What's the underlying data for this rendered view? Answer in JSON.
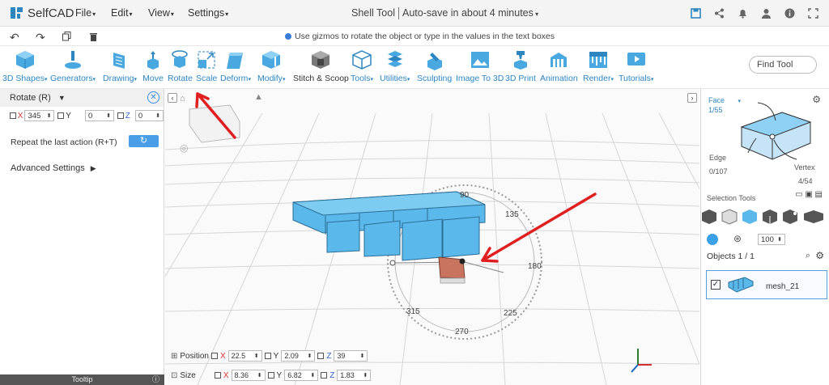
{
  "app": {
    "name": "SelfCAD"
  },
  "menu": {
    "file": "File",
    "edit": "Edit",
    "view": "View",
    "settings": "Settings"
  },
  "title": {
    "tool": "Shell Tool",
    "autosave": "Auto-save in about 4 minutes"
  },
  "hint": "Use gizmos to rotate the object or type in the values in the text boxes",
  "toolbar": {
    "items": [
      "3D Shapes",
      "Generators",
      "Drawing",
      "Move",
      "Rotate",
      "Scale",
      "Deform",
      "Modify",
      "Stitch & Scoop",
      "Tools",
      "Utilities",
      "Sculpting",
      "Image To 3D",
      "3D Print",
      "Animation",
      "Render",
      "Tutorials"
    ],
    "find_placeholder": "Find Tool"
  },
  "left_panel": {
    "header": "Rotate (R)",
    "x_label": "X",
    "x_value": "345",
    "y_label": "Y",
    "y_value": "0",
    "z_label": "Z",
    "z_value": "0",
    "repeat_label": "Repeat the last action (R+T)",
    "advanced": "Advanced Settings",
    "tooltip": "Tooltip"
  },
  "viewport": {
    "dial_labels": [
      "90",
      "135",
      "180",
      "225",
      "270",
      "315"
    ]
  },
  "right_panel": {
    "face_label": "Face",
    "face_count": "1/55",
    "edge_label": "Edge",
    "edge_count": "0/107",
    "vertex_label": "Vertex",
    "vertex_count": "4/54",
    "selection_tools": "Selection Tools",
    "percent": "100",
    "objects_header": "Objects 1 / 1",
    "object_name": "mesh_21"
  },
  "bottom": {
    "position_label": "Position",
    "pos_x": "22.5",
    "pos_y": "2.09",
    "pos_z": "39",
    "size_label": "Size",
    "size_x": "8.36",
    "size_y": "6.82",
    "size_z": "1.83"
  },
  "colors": {
    "accent": "#2e86c1",
    "annotation": "#e02020",
    "mesh": "#5bb8ea",
    "face_selected": "#c9745f"
  }
}
